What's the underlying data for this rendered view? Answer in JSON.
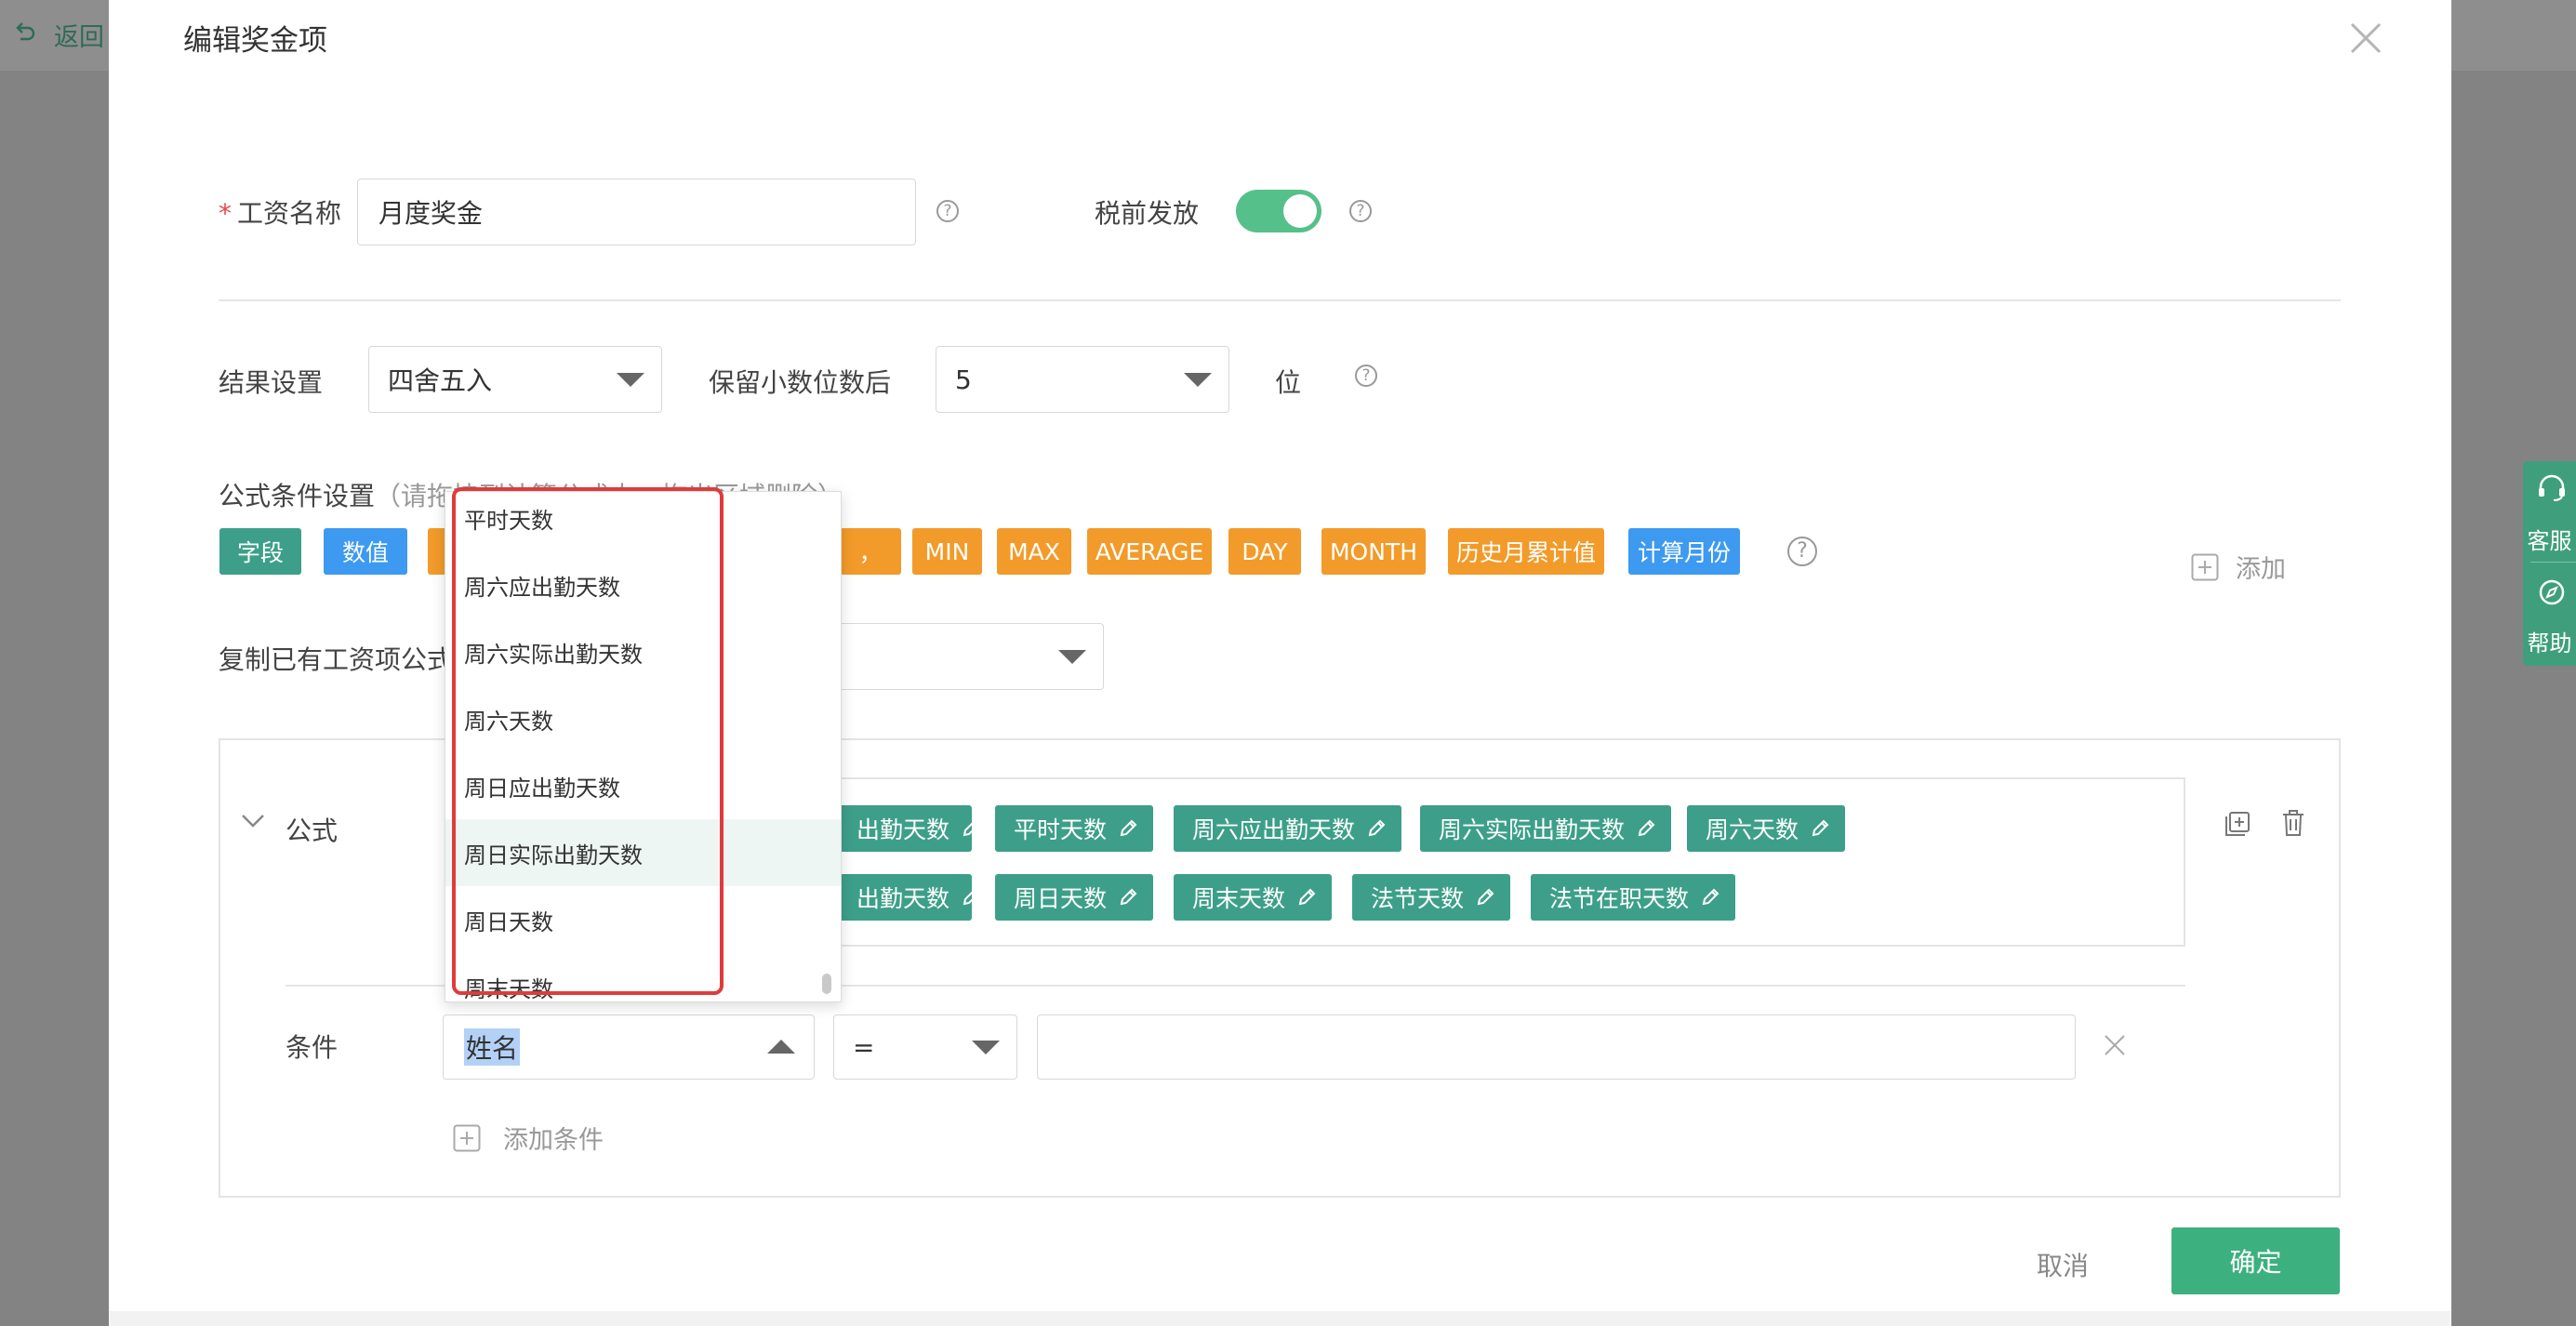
{
  "background": {
    "back_label": "返回"
  },
  "modal": {
    "title": "编辑奖金项",
    "salary_name": {
      "label": "工资名称",
      "required_mark": "*",
      "value": "月度奖金"
    },
    "pretax": {
      "label": "税前发放",
      "enabled": true
    },
    "result": {
      "label": "结果设置",
      "rounding_value": "四舍五入",
      "decimals_label": "保留小数位数后",
      "decimals_value": "5",
      "unit": "位"
    },
    "formula_settings": {
      "label": "公式条件设置",
      "hint": "（请拖拽到计算公式中，拖出区域删除）",
      "chips": [
        {
          "text": "字段",
          "color": "teal"
        },
        {
          "text": "数值",
          "color": "blue"
        },
        {
          "text": "",
          "color": "orange"
        },
        {
          "text": "，",
          "color": "orange"
        },
        {
          "text": "MIN",
          "color": "orange"
        },
        {
          "text": "MAX",
          "color": "orange"
        },
        {
          "text": "AVERAGE",
          "color": "orange"
        },
        {
          "text": "DAY",
          "color": "orange"
        },
        {
          "text": "MONTH",
          "color": "orange"
        },
        {
          "text": "历史月累计值",
          "color": "orange"
        },
        {
          "text": "计算月份",
          "color": "blue"
        }
      ],
      "add_label": "添加"
    },
    "copy_formula": {
      "label": "复制已有工资项公式"
    },
    "formula_card": {
      "label": "公式",
      "tags_row1": [
        "出勤天数",
        "平时天数",
        "周六应出勤天数",
        "周六实际出勤天数",
        "周六天数"
      ],
      "tags_row2": [
        "出勤天数",
        "周日天数",
        "周末天数",
        "法节天数",
        "法节在职天数"
      ]
    },
    "condition": {
      "label": "条件",
      "field_value": "姓名",
      "operator_value": "=",
      "value_input": "",
      "add_condition_label": "添加条件"
    },
    "footer": {
      "cancel_label": "取消",
      "ok_label": "确定"
    }
  },
  "dropdown": {
    "items": [
      "平时天数",
      "周六应出勤天数",
      "周六实际出勤天数",
      "周六天数",
      "周日应出勤天数",
      "周日实际出勤天数",
      "周日天数",
      "周末天数"
    ],
    "hovered_index": 5
  },
  "side_float": {
    "service_label": "客服",
    "help_label": "帮助"
  },
  "colors": {
    "accent": "#3cb07f",
    "teal_tag": "#3d9f8a",
    "blue_tag": "#3d9af0",
    "orange_tag": "#f29b2a",
    "highlight": "#e03b3b"
  }
}
